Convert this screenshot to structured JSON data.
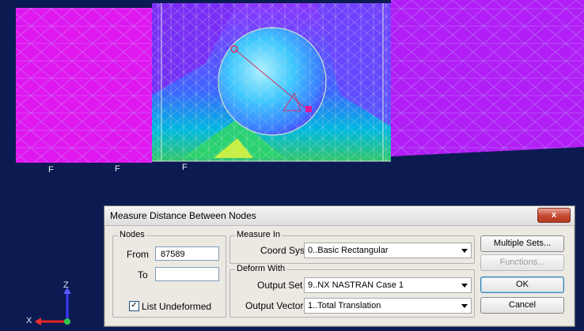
{
  "dialog": {
    "title": "Measure Distance Between Nodes",
    "close_label": "x"
  },
  "nodes": {
    "group_label": "Nodes",
    "from_label": "From",
    "from_value": "87589",
    "to_label": "To",
    "to_value": "",
    "list_undeformed_label": "List Undeformed",
    "list_undeformed_checked": true
  },
  "measure_in": {
    "group_label": "Measure In",
    "coord_sys_label": "Coord Sys",
    "coord_sys_value": "0..Basic Rectangular"
  },
  "deform_with": {
    "group_label": "Deform With",
    "output_set_label": "Output Set",
    "output_set_value": "9..NX NASTRAN Case 1",
    "output_vector_label": "Output Vector",
    "output_vector_value": "1..Total Translation"
  },
  "buttons": {
    "multiple_sets": "Multiple Sets...",
    "functions": "Functions...",
    "ok": "OK",
    "cancel": "Cancel"
  },
  "viewport": {
    "axis_z": "Z",
    "axis_x": "X",
    "force_marker": "F",
    "colors": {
      "background": "#0c1a52",
      "fringe_high": "#ff00ff",
      "fringe_mid": "#6a3cff",
      "fringe_low": "#00c8c8",
      "mesh_line": "#c8d8c8"
    }
  }
}
